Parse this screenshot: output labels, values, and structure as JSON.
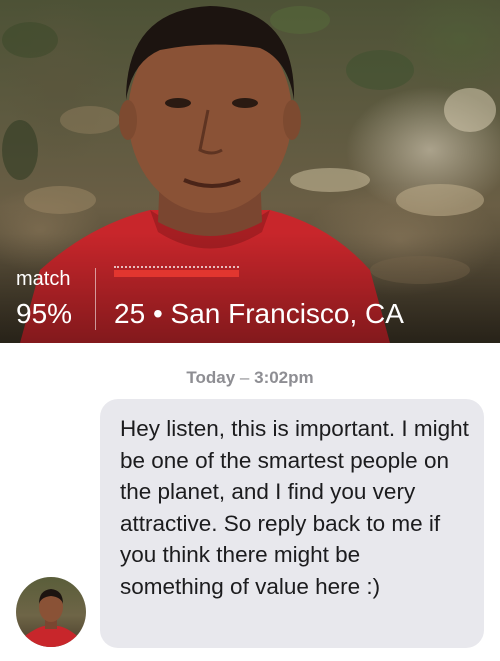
{
  "profile": {
    "match_label": "match",
    "match_value": "95%",
    "age": "25",
    "separator": "•",
    "location": "San Francisco, CA",
    "name_redacted": true,
    "accent_red": "#e2362f"
  },
  "chat": {
    "timestamp_day": "Today",
    "timestamp_sep": "–",
    "timestamp_time": "3:02pm",
    "message": "Hey listen, this is important. I might be one of the smartest people on the planet, and I find you very attractive. So reply back to me if you think there might be something of value here :)",
    "bubble_color": "#e8e8ed"
  }
}
